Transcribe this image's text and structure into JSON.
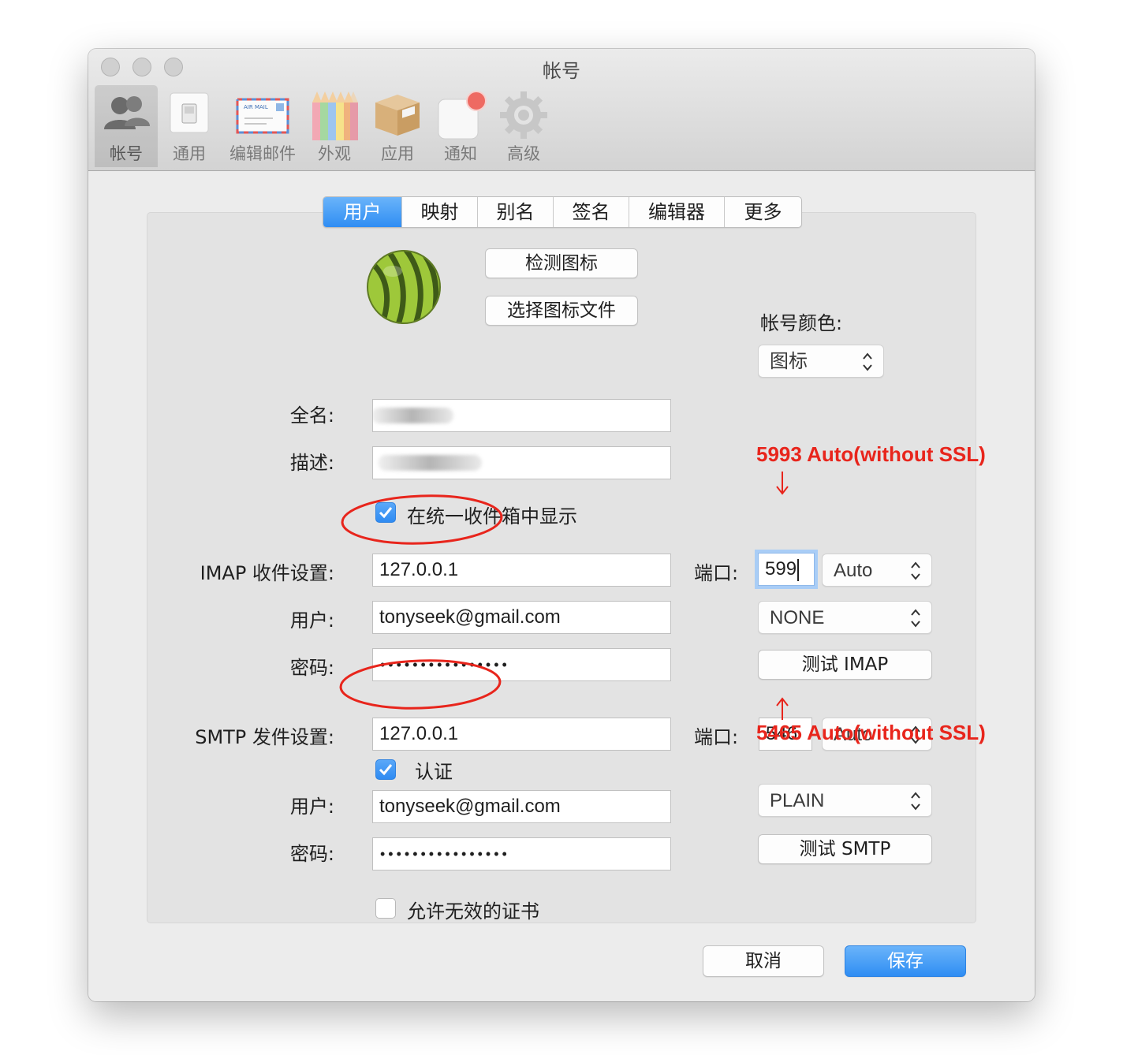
{
  "window": {
    "title": "帐号"
  },
  "toolbar": {
    "items": [
      {
        "label": "帐号",
        "icon": "accounts-icon",
        "active": true
      },
      {
        "label": "通用",
        "icon": "switch-icon"
      },
      {
        "label": "编辑邮件",
        "icon": "airmail-envelope-icon",
        "icon_text": "AIR MAIL"
      },
      {
        "label": "外观",
        "icon": "colored-pencils-icon"
      },
      {
        "label": "应用",
        "icon": "package-box-icon"
      },
      {
        "label": "通知",
        "icon": "notification-badge-icon"
      },
      {
        "label": "高级",
        "icon": "gear-icon"
      }
    ]
  },
  "tabs": [
    "用户",
    "映射",
    "别名",
    "签名",
    "编辑器",
    "更多"
  ],
  "selected_tab": "用户",
  "account_icon": {
    "icon": "watermelon-ball-icon"
  },
  "buttons": {
    "detect_icon": "检测图标",
    "choose_icon_file": "选择图标文件",
    "test_imap": "测试 IMAP",
    "test_smtp": "测试 SMTP",
    "cancel": "取消",
    "save": "保存"
  },
  "account_color": {
    "label": "帐号颜色:",
    "value": "图标"
  },
  "labels": {
    "full_name": "全名:",
    "description": "描述:",
    "imap_server": "IMAP 收件设置:",
    "user": "用户:",
    "password": "密码:",
    "smtp_server": "SMTP 发件设置:",
    "port": "端口:"
  },
  "checkboxes": {
    "unified_inbox": {
      "label": "在统一收件箱中显示",
      "checked": true
    },
    "auth": {
      "label": "认证",
      "checked": true
    },
    "allow_invalid_cert": {
      "label": "允许无效的证书",
      "checked": false
    }
  },
  "imap": {
    "server": "127.0.0.1",
    "user": "tonyseek@gmail.com",
    "password": "••••••••••••••••",
    "port": "599",
    "security": "Auto",
    "auth_method": "NONE"
  },
  "smtp": {
    "server": "127.0.0.1",
    "user": "tonyseek@gmail.com",
    "password": "••••••••••••••••",
    "port": "546",
    "security": "Auto",
    "auth_method": "PLAIN"
  },
  "annotations": {
    "imap_note": "5993  Auto(without SSL)",
    "smtp_note": "5465  Auto(without SSL)",
    "color": "#e8251c"
  }
}
